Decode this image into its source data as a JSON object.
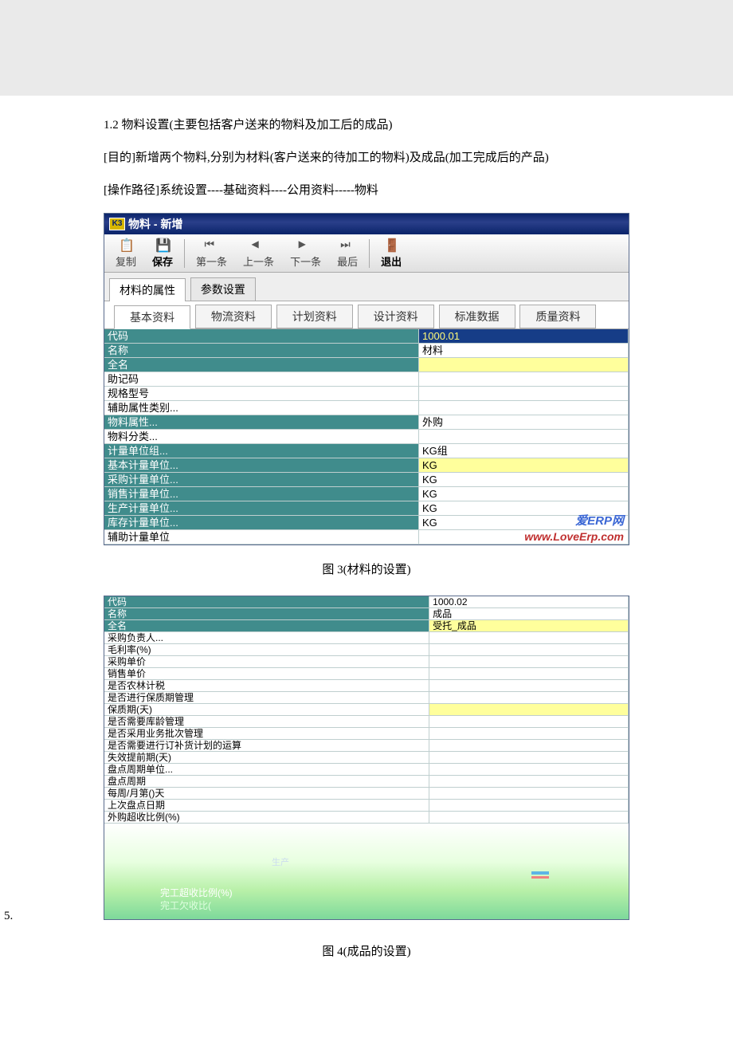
{
  "intro": {
    "heading": "1.2 物料设置(主要包括客户送来的物料及加工后的成品)",
    "purpose": "[目的]新增两个物料,分别为材料(客户送来的待加工的物料)及成品(加工完成后的产品)",
    "path": "[操作路径]系统设置----基础资料----公用资料-----物料"
  },
  "window1": {
    "title": "物料 - 新增",
    "toolbar": {
      "copy": "复制",
      "save": "保存",
      "first": "第一条",
      "prev": "上一条",
      "next": "下一条",
      "last": "最后",
      "exit": "退出"
    },
    "tabs": [
      "材料的属性",
      "参数设置"
    ],
    "subtabs": [
      "基本资料",
      "物流资料",
      "计划资料",
      "设计资料",
      "标准数据",
      "质量资料"
    ],
    "rows": [
      {
        "label": "代码",
        "value": "1000.01",
        "labelCls": "row-teal",
        "valCls": "valSel"
      },
      {
        "label": "名称",
        "value": "材料",
        "labelCls": "row-teal",
        "valCls": "val"
      },
      {
        "label": "全名",
        "value": "",
        "labelCls": "row-teal",
        "valCls": "valY"
      },
      {
        "label": "助记码",
        "value": "",
        "labelCls": "row-white",
        "valCls": "val"
      },
      {
        "label": "规格型号",
        "value": "",
        "labelCls": "row-white",
        "valCls": "val"
      },
      {
        "label": "辅助属性类别...",
        "value": "",
        "labelCls": "row-white",
        "valCls": "val"
      },
      {
        "label": "物料属性...",
        "value": "外购",
        "labelCls": "row-teal",
        "valCls": "val"
      },
      {
        "label": "物料分类...",
        "value": "",
        "labelCls": "row-white",
        "valCls": "val"
      },
      {
        "label": "计量单位组...",
        "value": "KG组",
        "labelCls": "row-teal",
        "valCls": "val"
      },
      {
        "label": "基本计量单位...",
        "value": "KG",
        "labelCls": "row-teal",
        "valCls": "valY"
      },
      {
        "label": "采购计量单位...",
        "value": "KG",
        "labelCls": "row-teal",
        "valCls": "val"
      },
      {
        "label": "销售计量单位...",
        "value": "KG",
        "labelCls": "row-teal",
        "valCls": "val"
      },
      {
        "label": "生产计量单位...",
        "value": "KG",
        "labelCls": "row-teal",
        "valCls": "val"
      },
      {
        "label": "库存计量单位...",
        "value": "KG",
        "labelCls": "row-teal",
        "valCls": "val"
      },
      {
        "label": "辅助计量单位",
        "value": "",
        "labelCls": "row-white",
        "valCls": "val"
      }
    ],
    "watermark_logo": "爱ERP网",
    "watermark_url": "www.LoveErp.com"
  },
  "caption1": "图 3(材料的设置)",
  "window2": {
    "rows": [
      {
        "label": "代码",
        "value": "1000.02",
        "labelCls": "row-teal",
        "valCls": "val"
      },
      {
        "label": "名称",
        "value": "成品",
        "labelCls": "row-teal",
        "valCls": "val"
      },
      {
        "label": "全名",
        "value": "受托_成品",
        "labelCls": "row-teal",
        "valCls": "valY"
      },
      {
        "label": "采购负责人...",
        "value": "",
        "labelCls": "row-white",
        "valCls": "val"
      },
      {
        "label": "毛利率(%)",
        "value": "",
        "labelCls": "row-white",
        "valCls": "val"
      },
      {
        "label": "采购单价",
        "value": "",
        "labelCls": "row-white",
        "valCls": "val"
      },
      {
        "label": "销售单价",
        "value": "",
        "labelCls": "row-white",
        "valCls": "val"
      },
      {
        "label": "是否农林计税",
        "value": "",
        "labelCls": "row-white",
        "valCls": "val"
      },
      {
        "label": "是否进行保质期管理",
        "value": "",
        "labelCls": "row-white",
        "valCls": "val"
      },
      {
        "label": "保质期(天)",
        "value": "",
        "labelCls": "row-white",
        "valCls": "valY"
      },
      {
        "label": "是否需要库龄管理",
        "value": "",
        "labelCls": "row-white",
        "valCls": "val"
      },
      {
        "label": "是否采用业务批次管理",
        "value": "",
        "labelCls": "row-white",
        "valCls": "val"
      },
      {
        "label": "是否需要进行订补货计划的运算",
        "value": "",
        "labelCls": "row-white",
        "valCls": "val"
      },
      {
        "label": "失效提前期(天)",
        "value": "",
        "labelCls": "row-white",
        "valCls": "val"
      },
      {
        "label": "盘点周期单位...",
        "value": "",
        "labelCls": "row-white",
        "valCls": "val"
      },
      {
        "label": "盘点周期",
        "value": "",
        "labelCls": "row-white",
        "valCls": "val"
      },
      {
        "label": "每周/月第()天",
        "value": "",
        "labelCls": "row-white",
        "valCls": "val"
      },
      {
        "label": "上次盘点日期",
        "value": "",
        "labelCls": "row-white",
        "valCls": "val"
      },
      {
        "label": "外购超收比例(%)",
        "value": "",
        "labelCls": "row-white",
        "valCls": "val"
      }
    ],
    "bottom": {
      "line1": "完工超收比例(%)",
      "line2": "完工欠收比(",
      "fadelabel": "生产"
    }
  },
  "listnum": "5.",
  "caption2": "图 4(成品的设置)"
}
